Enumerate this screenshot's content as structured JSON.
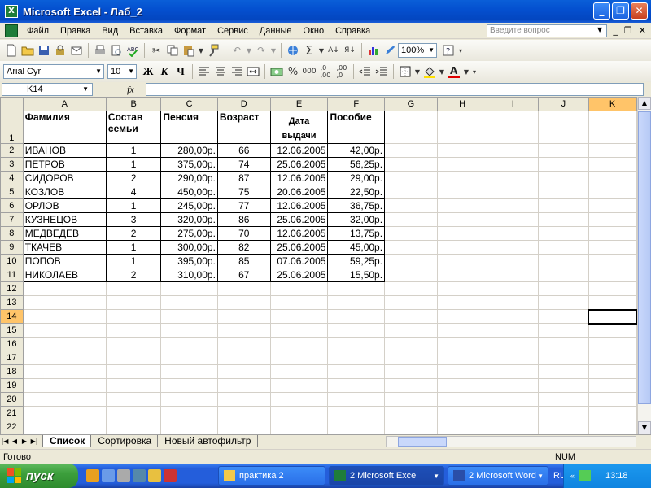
{
  "window": {
    "title": "Microsoft Excel - Лаб_2"
  },
  "menu": {
    "items": [
      "Файл",
      "Правка",
      "Вид",
      "Вставка",
      "Формат",
      "Сервис",
      "Данные",
      "Окно",
      "Справка"
    ],
    "help_placeholder": "Введите вопрос"
  },
  "toolbar": {
    "zoom": "100%"
  },
  "format": {
    "font": "Arial Cyr",
    "size": "10",
    "bold": "Ж",
    "italic": "К",
    "underline": "Ч"
  },
  "formula_bar": {
    "name_box": "K14",
    "fx": "fx"
  },
  "columns": [
    "A",
    "B",
    "C",
    "D",
    "E",
    "F",
    "G",
    "H",
    "I",
    "J",
    "K"
  ],
  "header": {
    "surname": "Фамилия",
    "family1": "Состав",
    "family2": "семьи",
    "pension": "Пенсия",
    "age": "Возраст",
    "date1": "Дата",
    "date2": "выдачи",
    "benefit": "Пособие"
  },
  "rows": [
    {
      "name": "ИВАНОВ",
      "family": "1",
      "pension": "280,00р.",
      "age": "66",
      "date": "12.06.2005",
      "benefit": "42,00р."
    },
    {
      "name": "ПЕТРОВ",
      "family": "1",
      "pension": "375,00р.",
      "age": "74",
      "date": "25.06.2005",
      "benefit": "56,25р."
    },
    {
      "name": "СИДОРОВ",
      "family": "2",
      "pension": "290,00р.",
      "age": "87",
      "date": "12.06.2005",
      "benefit": "29,00р."
    },
    {
      "name": "КОЗЛОВ",
      "family": "4",
      "pension": "450,00р.",
      "age": "75",
      "date": "20.06.2005",
      "benefit": "22,50р."
    },
    {
      "name": "ОРЛОВ",
      "family": "1",
      "pension": "245,00р.",
      "age": "77",
      "date": "12.06.2005",
      "benefit": "36,75р."
    },
    {
      "name": "КУЗНЕЦОВ",
      "family": "3",
      "pension": "320,00р.",
      "age": "86",
      "date": "25.06.2005",
      "benefit": "32,00р."
    },
    {
      "name": "МЕДВЕДЕВ",
      "family": "2",
      "pension": "275,00р.",
      "age": "70",
      "date": "12.06.2005",
      "benefit": "13,75р."
    },
    {
      "name": "ТКАЧЕВ",
      "family": "1",
      "pension": "300,00р.",
      "age": "82",
      "date": "25.06.2005",
      "benefit": "45,00р."
    },
    {
      "name": "ПОПОВ",
      "family": "1",
      "pension": "395,00р.",
      "age": "85",
      "date": "07.06.2005",
      "benefit": "59,25р."
    },
    {
      "name": "НИКОЛАЕВ",
      "family": "2",
      "pension": "310,00р.",
      "age": "67",
      "date": "25.06.2005",
      "benefit": "15,50р."
    }
  ],
  "row_numbers": [
    "1",
    "2",
    "3",
    "4",
    "5",
    "6",
    "7",
    "8",
    "9",
    "10",
    "11",
    "12",
    "13",
    "14",
    "15",
    "16",
    "17",
    "18",
    "19",
    "20",
    "21",
    "22"
  ],
  "sheets": [
    "Список",
    "Сортировка",
    "Новый автофильтр"
  ],
  "status": {
    "left": "Готово",
    "num": "NUM"
  },
  "taskbar": {
    "start": "пуск",
    "buttons": [
      "практика 2",
      "2 Microsoft Excel",
      "2 Microsoft Word"
    ],
    "lang": "RU",
    "clock": "13:18"
  },
  "colors": {
    "title_blue": "#0a5fd8",
    "start_green": "#3c9f3c",
    "taskbar_blue": "#245edb",
    "selection_orange": "#ffc469"
  }
}
